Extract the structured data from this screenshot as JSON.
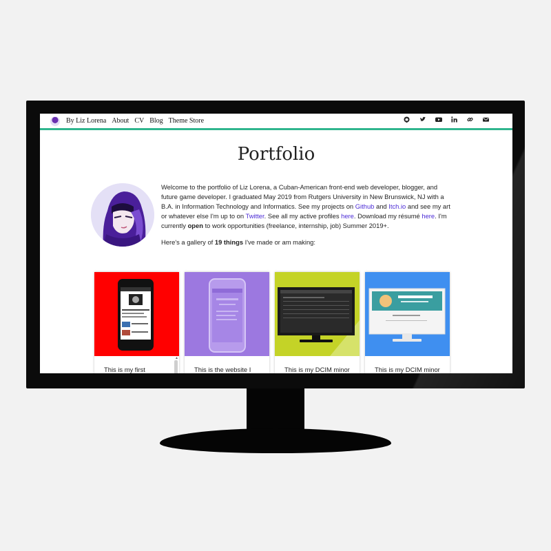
{
  "navbar": {
    "brand": "By Liz Lorena",
    "links": [
      "About",
      "CV",
      "Blog",
      "Theme Store"
    ],
    "icons": [
      "github-icon",
      "twitter-icon",
      "youtube-icon",
      "linkedin-icon",
      "link-icon",
      "email-icon"
    ],
    "accent_color": "#2fb58e"
  },
  "page": {
    "title": "Portfolio"
  },
  "intro": {
    "p1_a": "Welcome to the portfolio of Liz Lorena, a Cuban-American front-end web developer, blogger, and future game developer. I graduated May 2019 from Rutgers University in New Brunswick, NJ with a B.A. in Information Technology and Informatics. See my projects on ",
    "github_link": "Github",
    "p1_b": " and ",
    "itch_link": "Itch.io",
    "p1_c": " and see my art or whatever else I'm up to on ",
    "twitter_link": "Twitter",
    "p1_d": ". See all my active profiles ",
    "profiles_link": "here",
    "p1_e": ". Download my résumé ",
    "resume_link": "here",
    "p1_f": ". I'm currently ",
    "open_bold": "open",
    "p1_g": " to work opportunities (freelance, internship, job) Summer 2019+.",
    "p2_a": "Here's a gallery of ",
    "count_bold": "19 things",
    "p2_b": " I've made or am making:"
  },
  "gallery": [
    {
      "caption": "This is my first",
      "bg": "#ff0000"
    },
    {
      "caption": "This is the website I",
      "bg": "#9c78e0"
    },
    {
      "caption": "This is my DCIM minor",
      "bg": "#c4d327"
    },
    {
      "caption": "This is my DCIM minor",
      "bg": "#3f8ff0"
    }
  ]
}
